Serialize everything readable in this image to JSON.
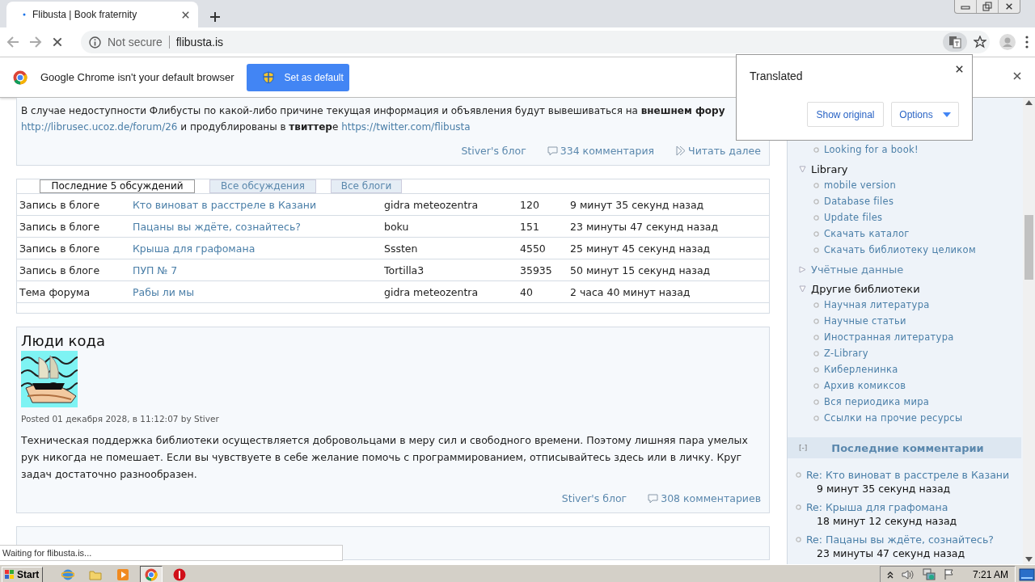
{
  "browser": {
    "tab": {
      "title": "Flibusta | Book fraternity"
    },
    "address": {
      "security": "Not secure",
      "url": "flibusta.is"
    },
    "infobar": {
      "message": "Google Chrome isn't your default browser",
      "button": "Set as default"
    },
    "translate_popup": {
      "title": "Translated",
      "buttons": [
        {
          "label": "Show original",
          "kind": "plain"
        },
        {
          "label": "Options",
          "kind": "dropdown"
        }
      ]
    }
  },
  "posts": [
    {
      "paragraphs": [
        [
          {
            "kind": "text",
            "text": "В случае недоступности Флибусты по какой-либо причине текущая информация и объявления будут вывешиваться на **внешнем фору**"
          }
        ],
        [
          {
            "kind": "link",
            "text": "http://librusec.ucoz.de/forum/26"
          },
          {
            "kind": "text",
            "text": " и продублированы в **твиттер**е "
          },
          {
            "kind": "link",
            "text": "https://twitter.com/flibusta"
          }
        ]
      ],
      "footer": [
        {
          "kind": "blog",
          "text": "Stiver's блог"
        },
        {
          "kind": "comments",
          "text": "334 комментария"
        },
        {
          "kind": "more",
          "text": "Читать далее"
        }
      ]
    },
    {
      "title": "Люди кода",
      "image": {
        "kind": "picture"
      },
      "posted": "Posted 01 декабря 2028, в 11:12:07 by Stiver",
      "paragraphs": [
        [
          {
            "kind": "text",
            "text": "Техническая поддержка библиотеки осуществляется добровольцами в меру сил и свободного времени. Поэтому лишняя пара умелых рук никогда не помешает. Если вы чувствуете в себе желание помочь с программированием, отписывайтесь здесь или в личку. Круг задач достаточно разнообразен."
          }
        ]
      ],
      "footer": [
        {
          "kind": "blog",
          "text": "Stiver's блог"
        },
        {
          "kind": "comments",
          "text": "308 комментариев"
        }
      ]
    }
  ],
  "discussions": {
    "tabs": [
      {
        "label": "Последние 5 обсуждений",
        "selected": true
      },
      {
        "label": "Все обсуждения",
        "selected": false
      },
      {
        "label": "Все блоги",
        "selected": false
      }
    ],
    "rows": [
      {
        "type": "Запись в блоге",
        "title": "Кто виноват в расстреле в Казани",
        "author": "gidra meteozentra",
        "count": "120",
        "time": "9 минут 35 секунд назад"
      },
      {
        "type": "Запись в блоге",
        "title": "Пацаны вы ждёте, сознайтесь?",
        "author": "boku",
        "count": "151",
        "time": "23 минуты 47 секунд назад"
      },
      {
        "type": "Запись в блоге",
        "title": "Крыша для графомана",
        "author": "Sssten",
        "count": "4550",
        "time": "25 минут 45 секунд назад"
      },
      {
        "type": "Запись в блоге",
        "title": "ПУП № 7",
        "author": "Tortilla3",
        "count": "35935",
        "time": "50 минут 15 секунд назад"
      },
      {
        "type": "Тема форума",
        "title": "Рабы ли мы",
        "author": "gidra meteozentra",
        "count": "40",
        "time": "2 часа 40 минут назад"
      }
    ]
  },
  "sidebar": {
    "items": [
      "Looking for a book!"
    ],
    "groups": [
      {
        "label": "Library",
        "expanded": true,
        "children": [
          "mobile version",
          "Database files",
          "Update files",
          "Скачать каталог",
          "Скачать библиотеку целиком"
        ]
      },
      {
        "label": "Учётные данные",
        "expanded": false
      },
      {
        "label": "Другие библиотеки",
        "expanded": true,
        "children": [
          "Научная литература",
          "Научные статьи",
          "Иностранная литература",
          "Z-Library",
          "Киберленинка",
          "Архив комиксов",
          "Вся периодика мира",
          "Ссылки на прочие ресурсы"
        ]
      }
    ],
    "recent_comments": {
      "toggle": "[-]",
      "title": "Последние комментарии",
      "items": [
        {
          "title": "Re: Кто виноват в расстреле в Казани",
          "time": "9 минут 35 секунд назад"
        },
        {
          "title": "Re: Крыша для графомана",
          "time": "18 минут 12 секунд назад"
        },
        {
          "title": "Re: Пацаны вы ждёте, сознайтесь?",
          "time": "23 минуты 47 секунд назад"
        }
      ]
    }
  },
  "status_bar": "Waiting for flibusta.is...",
  "taskbar": {
    "start": "Start",
    "clock": "7:21 AM"
  }
}
